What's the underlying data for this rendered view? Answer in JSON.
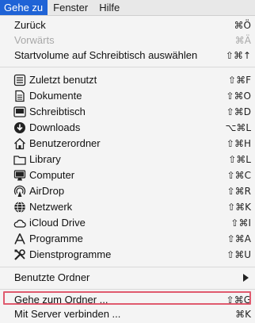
{
  "menubar": {
    "items": [
      "Gehe zu",
      "Fenster",
      "Hilfe"
    ],
    "active_index": 0
  },
  "menu": {
    "items": [
      {
        "label": "Zurück",
        "shortcut": "⌘Ö",
        "enabled": true
      },
      {
        "label": "Vorwärts",
        "shortcut": "⌘Ä",
        "enabled": false
      },
      {
        "label": "Startvolume auf Schreibtisch auswählen",
        "shortcut": "⇧⌘↑",
        "enabled": true
      },
      {
        "label": "Zuletzt benutzt",
        "shortcut": "⇧⌘F",
        "icon": "recents-icon",
        "enabled": true
      },
      {
        "label": "Dokumente",
        "shortcut": "⇧⌘O",
        "icon": "documents-icon",
        "enabled": true
      },
      {
        "label": "Schreibtisch",
        "shortcut": "⇧⌘D",
        "icon": "desktop-icon",
        "enabled": true
      },
      {
        "label": "Downloads",
        "shortcut": "⌥⌘L",
        "icon": "downloads-icon",
        "enabled": true
      },
      {
        "label": "Benutzerordner",
        "shortcut": "⇧⌘H",
        "icon": "home-icon",
        "enabled": true
      },
      {
        "label": "Library",
        "shortcut": "⇧⌘L",
        "icon": "library-icon",
        "enabled": true
      },
      {
        "label": "Computer",
        "shortcut": "⇧⌘C",
        "icon": "computer-icon",
        "enabled": true
      },
      {
        "label": "AirDrop",
        "shortcut": "⇧⌘R",
        "icon": "airdrop-icon",
        "enabled": true
      },
      {
        "label": "Netzwerk",
        "shortcut": "⇧⌘K",
        "icon": "network-icon",
        "enabled": true
      },
      {
        "label": "iCloud Drive",
        "shortcut": "⇧⌘I",
        "icon": "icloud-icon",
        "enabled": true
      },
      {
        "label": "Programme",
        "shortcut": "⇧⌘A",
        "icon": "applications-icon",
        "enabled": true
      },
      {
        "label": "Dienstprogramme",
        "shortcut": "⇧⌘U",
        "icon": "utilities-icon",
        "enabled": true
      },
      {
        "label": "Benutzte Ordner",
        "submenu": true,
        "enabled": true
      },
      {
        "label": "Gehe zum Ordner ...",
        "shortcut": "⇧⌘G",
        "enabled": true
      },
      {
        "label": "Mit Server verbinden ...",
        "shortcut": "⌘K",
        "enabled": true,
        "highlighted": true
      }
    ]
  },
  "colors": {
    "menubar_active": "#1f63d6",
    "highlight_border": "#e05a6e",
    "disabled_text": "#a8a8a8"
  }
}
